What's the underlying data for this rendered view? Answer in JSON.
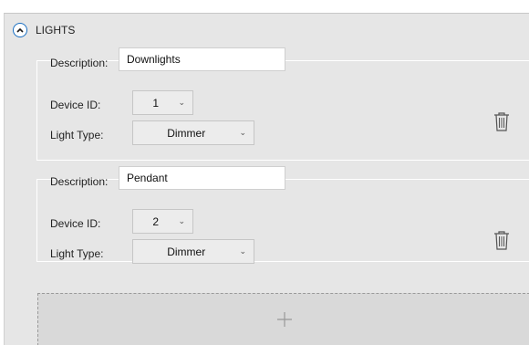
{
  "section": {
    "title": "LIGHTS",
    "collapse_icon": "chevron-up-icon"
  },
  "labels": {
    "description": "Description:",
    "device_id": "Device ID:",
    "light_type": "Light Type:"
  },
  "devices": [
    {
      "description": "Downlights",
      "device_id": "1",
      "light_type": "Dimmer"
    },
    {
      "description": "Pendant",
      "device_id": "2",
      "light_type": "Dimmer"
    }
  ],
  "icons": {
    "dropdown": "chevron-down-icon",
    "delete": "trash-icon",
    "add": "plus-icon"
  },
  "colors": {
    "panel_bg": "#e6e6e6",
    "accent": "#1a6fc2",
    "add_box_bg": "#d9d9d9"
  }
}
